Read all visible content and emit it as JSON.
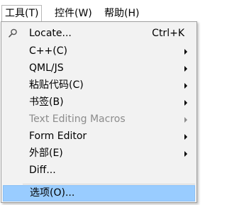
{
  "menubar": {
    "items": [
      {
        "label": "工具(T)"
      },
      {
        "label": "控件(W)"
      },
      {
        "label": "帮助(H)"
      }
    ]
  },
  "menu": {
    "items": [
      {
        "label": "Locate...",
        "shortcut": "Ctrl+K",
        "icon": "search-icon"
      },
      {
        "label": "C++(C)"
      },
      {
        "label": "QML/JS"
      },
      {
        "label": "粘贴代码(C)"
      },
      {
        "label": "书签(B)"
      },
      {
        "label": "Text Editing Macros",
        "disabled": true
      },
      {
        "label": "Form Editor"
      },
      {
        "label": "外部(E)"
      },
      {
        "label": "Diff..."
      },
      {
        "label": "选项(O)...",
        "highlighted": true
      }
    ]
  },
  "colors": {
    "highlight": "#99ccff",
    "menu_background": "#f2f2f2",
    "disabled_text": "#8c8c8c"
  }
}
